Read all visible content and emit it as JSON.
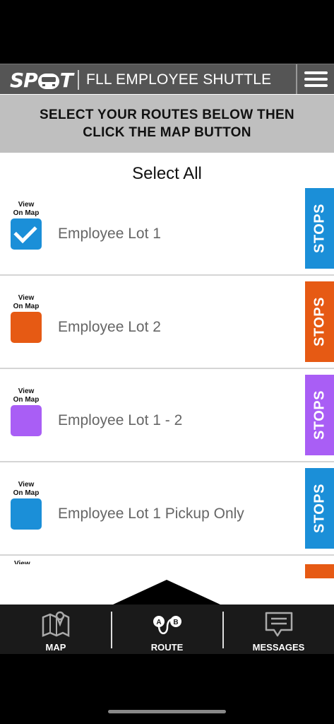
{
  "header": {
    "logo_text": "SPOT",
    "title": "FLL EMPLOYEE SHUTTLE",
    "menu_icon": "hamburger-icon"
  },
  "banner": {
    "line1": "SELECT YOUR ROUTES BELOW THEN",
    "line2": "CLICK THE MAP BUTTON"
  },
  "select_all": "Select All",
  "view_label_line1": "View",
  "view_label_line2": "On Map",
  "routes": [
    {
      "name": "Employee Lot 1",
      "color": "#1b8fd8",
      "checked": true,
      "stops_label": "STOPS"
    },
    {
      "name": "Employee Lot 2",
      "color": "#e65a14",
      "checked": false,
      "stops_label": "STOPS"
    },
    {
      "name": "Employee Lot 1 - 2",
      "color": "#a95ef5",
      "checked": false,
      "stops_label": "STOPS"
    },
    {
      "name": "Employee Lot 1 Pickup Only",
      "color": "#1b8fd8",
      "checked": false,
      "stops_label": "STOPS"
    }
  ],
  "nav": {
    "map": {
      "label": "MAP",
      "icon": "map-icon"
    },
    "route": {
      "label": "ROUTE",
      "icon": "route-icon"
    },
    "messages": {
      "label": "MESSAGES",
      "icon": "messages-icon"
    }
  },
  "colors": {
    "header_bg": "#555555",
    "banner_bg": "#bfbfbf",
    "nav_bg": "#1a1a1a"
  }
}
